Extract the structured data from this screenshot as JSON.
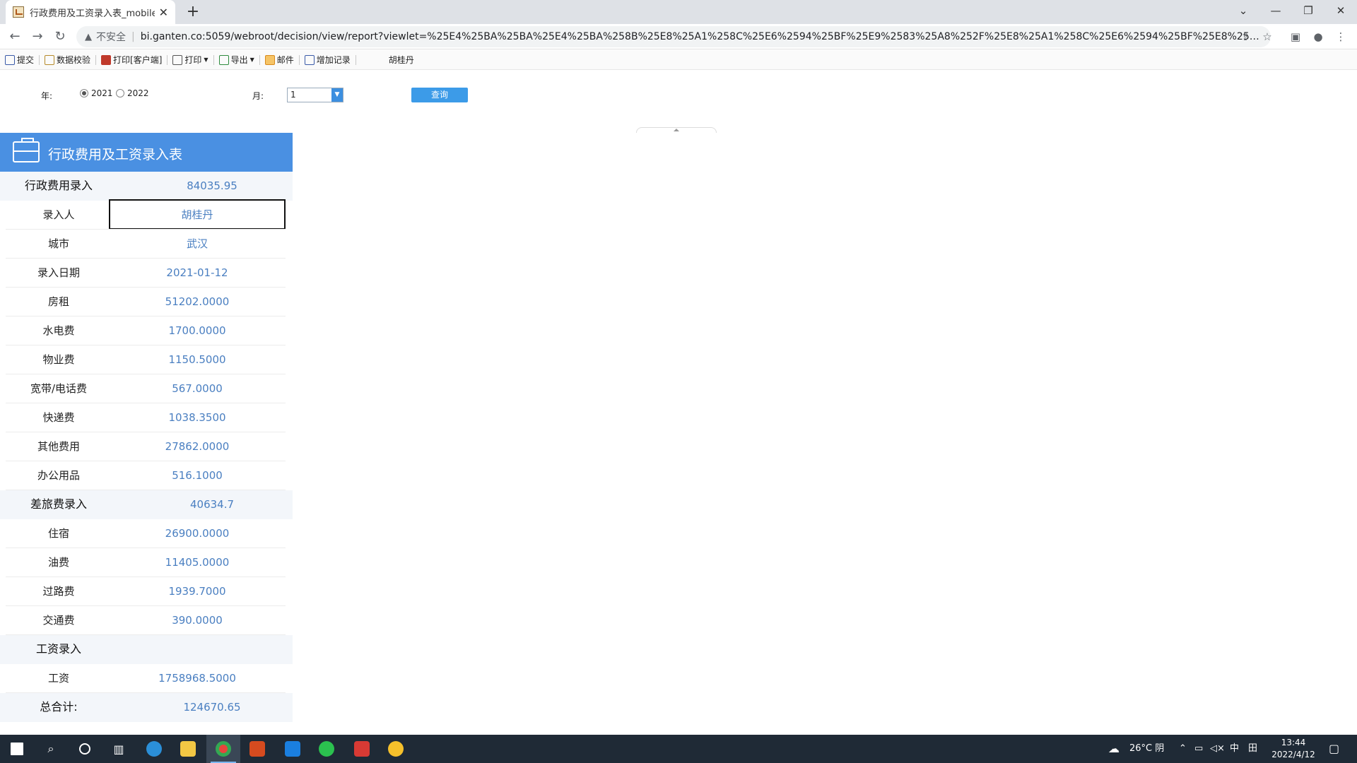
{
  "browser": {
    "tab_title": "行政费用及工资录入表_mobile",
    "tab_close": "✕",
    "new_tab": "+",
    "insecure_label": "不安全",
    "url": "bi.ganten.co:5059/webroot/decision/view/report?viewlet=%25E4%25BA%25BA%25E4%25BA%258B%25E8%25A1%258C%25E6%2594%25BF%25E9%2583%25A8%252F%25E8%25A1%258C%25E6%2594%25BF%25E8%25B4%25B..."
  },
  "toolbar": {
    "submit": "提交",
    "validate": "数据校验",
    "print_client": "打印[客户端]",
    "print": "打印",
    "export": "导出",
    "mail": "邮件",
    "add_record": "增加记录",
    "user": "胡桂丹"
  },
  "params": {
    "year_label": "年:",
    "year_options": [
      "2021",
      "2022"
    ],
    "year_selected": "2021",
    "month_label": "月:",
    "month_value": "1",
    "query_button": "查询"
  },
  "report": {
    "title": "行政费用及工资录入表",
    "admin_section": {
      "label": "行政费用录入",
      "value": "84035.95"
    },
    "admin_items": [
      {
        "label": "录入人",
        "value": "胡桂丹"
      },
      {
        "label": "城市",
        "value": "武汉"
      },
      {
        "label": "录入日期",
        "value": "2021-01-12"
      },
      {
        "label": "房租",
        "value": "51202.0000"
      },
      {
        "label": "水电费",
        "value": "1700.0000"
      },
      {
        "label": "物业费",
        "value": "1150.5000"
      },
      {
        "label": "宽带/电话费",
        "value": "567.0000"
      },
      {
        "label": "快递费",
        "value": "1038.3500"
      },
      {
        "label": "其他费用",
        "value": "27862.0000"
      },
      {
        "label": "办公用品",
        "value": "516.1000"
      }
    ],
    "travel_section": {
      "label": "差旅费录入",
      "value": "40634.7"
    },
    "travel_items": [
      {
        "label": "住宿",
        "value": "26900.0000"
      },
      {
        "label": "油费",
        "value": "11405.0000"
      },
      {
        "label": "过路费",
        "value": "1939.7000"
      },
      {
        "label": "交通费",
        "value": "390.0000"
      }
    ],
    "salary_section": {
      "label": "工资录入",
      "value": ""
    },
    "salary_items": [
      {
        "label": "工资",
        "value": "1758968.5000"
      }
    ],
    "total": {
      "label": "总合计:",
      "value": "124670.65"
    }
  },
  "taskbar": {
    "weather": "26°C 阴",
    "ime": "中",
    "time": "13:44",
    "date": "2022/4/12"
  }
}
